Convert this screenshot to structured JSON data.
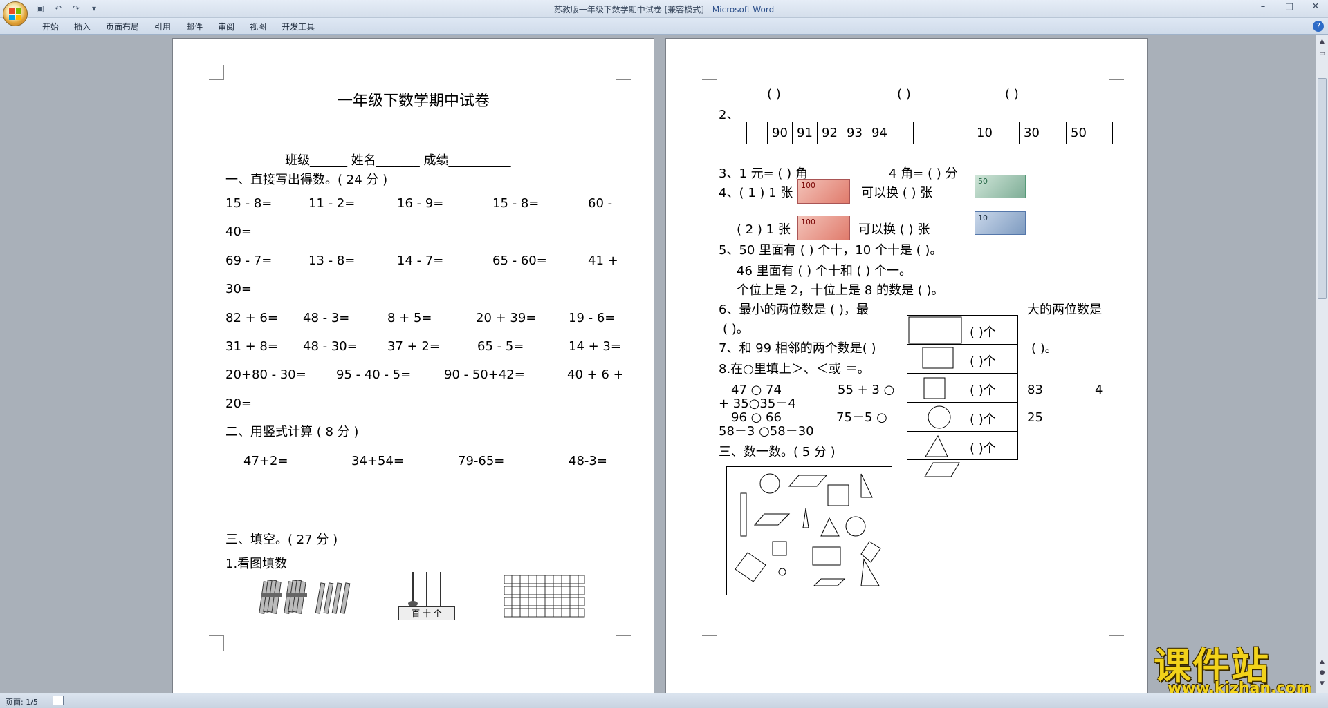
{
  "window": {
    "title_doc": "苏教版一年级下数学期中试卷 [兼容模式] - ",
    "title_app": "Microsoft Word",
    "controls": [
      "–",
      "□",
      "✕"
    ]
  },
  "quick_access": [
    "save-icon",
    "undo-icon",
    "redo-icon",
    "customize-icon"
  ],
  "ribbon_tabs": [
    "开始",
    "插入",
    "页面布局",
    "引用",
    "邮件",
    "审阅",
    "视图",
    "开发工具"
  ],
  "page1": {
    "title": "一年级下数学期中试卷",
    "info": "班级______      姓名_______      成绩__________",
    "s1": "一、直接写出得数。( 24 分 )",
    "r1": [
      "15 - 8=",
      "11 - 2=",
      "16 - 9=",
      "15 - 8=",
      "60 -"
    ],
    "r1b": "40=",
    "r2": [
      "69 - 7=",
      "13 - 8=",
      "14 - 7=",
      "65 - 60=",
      "41 +"
    ],
    "r2b": "30=",
    "r3": [
      "82 + 6=",
      "48 - 3=",
      "8 + 5=",
      "20 + 39=",
      "19 - 6="
    ],
    "r4": [
      "31 + 8=",
      "48 - 30=",
      "37 + 2=",
      "65 - 5=",
      "14 + 3="
    ],
    "r5": [
      "20+80 - 30=",
      "95 - 40 - 5=",
      "90 - 50+42=",
      "40 + 6 +"
    ],
    "r5b": "20=",
    "s2": "二、用竖式计算 ( 8 分 )",
    "r6": [
      "47+2=",
      "34+54=",
      "79-65=",
      "48-3="
    ],
    "s3": "三、填空。( 27 分 )",
    "q1": "1.看图填数",
    "abacus_label": "百 十 个"
  },
  "page2": {
    "parens_row": [
      "(        )",
      "(        )",
      "(        )"
    ],
    "q2": "2、",
    "seq1": [
      "",
      "90",
      "91",
      "92",
      "93",
      "94",
      ""
    ],
    "seq2": [
      "10",
      "",
      "30",
      "",
      "50",
      ""
    ],
    "q3a": "3、1 元= (         ) 角",
    "q3b": "4 角= (        ) 分",
    "q4a": "4、( 1 ) 1 张",
    "q4a_mid": "可以换 (          ) 张",
    "q4b": "( 2 ) 1 张",
    "q4b_mid": "可以换 (          ) 张",
    "note_100": "100",
    "note_50": "50",
    "note_10": "10",
    "q5a": "5、50 里面有 (        ) 个十，10 个十是 (      )。",
    "q5b": "46 里面有 (        ) 个十和 (        ) 个一。",
    "q5c": "个位上是 2，十位上是 8 的数是 (      )。",
    "q6a": "6、最小的两位数是 (        )，最",
    "q6b": "大的两位数是",
    "q6c": "(        )。",
    "q7": "7、和 99 相邻的两个数是(        )",
    "q7b": "(        )。",
    "q8": "8.在○里填上＞、＜或 ＝。",
    "q8r1a": "47  ○  74",
    "q8r1b": "55 + 3  ○",
    "q8r1c": "83",
    "q8r1d": "4",
    "q8r2": "+ 35○35－4",
    "q8r3a": "96  ○  66",
    "q8r3b": "75－5  ○",
    "q8r3c": "25",
    "q8r4": "58－3  ○58－30",
    "s3": "三、数一数。( 5 分 )",
    "count_cells": [
      "(       )个",
      "(       )个",
      "(       )个",
      "(       )个",
      "(       )个"
    ]
  },
  "status": {
    "page": "页面: 1/5"
  },
  "watermark": {
    "title": "课件站",
    "url": "www.kjzhan.com"
  }
}
